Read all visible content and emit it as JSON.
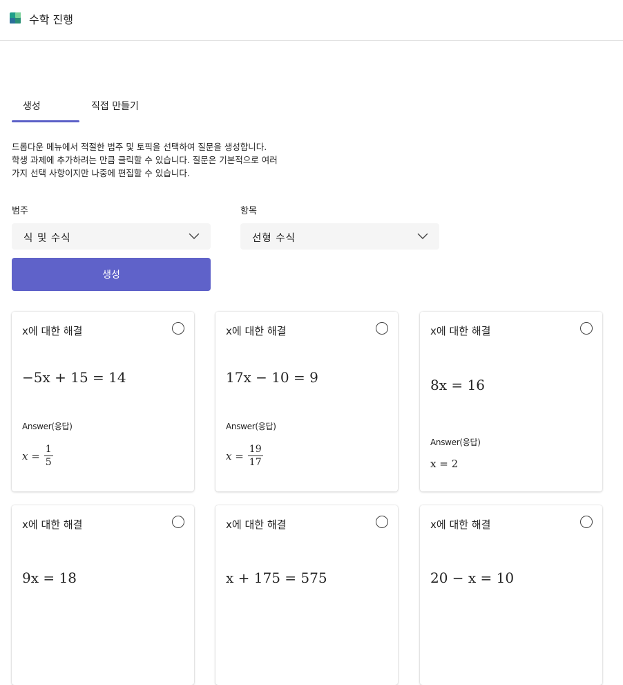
{
  "header": {
    "title": "수학 진행"
  },
  "tabs": [
    {
      "label": "생성",
      "selected": true
    },
    {
      "label": "직접 만들기",
      "selected": false
    }
  ],
  "description": [
    "드롭다운 메뉴에서 적절한 범주 및 토픽을 선택하여 질문을 생성합니다.",
    "학생 과제에 추가하려는 만큼 클릭할 수 있습니다. 질문은 기본적으로 여러",
    "가지 선택 사항이지만 나중에 편집할 수 있습니다."
  ],
  "category": {
    "label": "범주",
    "value": "식 및 수식"
  },
  "topic": {
    "label": "항목",
    "value": "선형 수식"
  },
  "generate_button": {
    "label": "생성"
  },
  "cards": [
    {
      "title": "x에 대한 해결",
      "equation": "−5x + 15 = 14",
      "answer_label": "Answer(응답)",
      "answer": "x = 1/5",
      "answer_lhs": "x =",
      "answer_num": "1",
      "answer_den": "5"
    },
    {
      "title": "x에 대한 해결",
      "equation": "17x − 10 = 9",
      "answer_label": "Answer(응답)",
      "answer": "x = 19/17",
      "answer_lhs": "x =",
      "answer_num": "19",
      "answer_den": "17"
    },
    {
      "title": "x에 대한 해결",
      "equation": "8x = 16",
      "answer_label": "Answer(응답)",
      "answer": "x = 2"
    },
    {
      "title": "x에 대한 해결",
      "equation": "9x = 18"
    },
    {
      "title": "x에 대한 해결",
      "equation": "x + 175 = 575"
    },
    {
      "title": "x에 대한 해결",
      "equation": "20 − x = 10"
    }
  ],
  "colors": {
    "accent": "#5b5fc7",
    "button": "#5f62c9",
    "select_bg": "#f5f5f5"
  },
  "icons": {
    "app": "app-logo-icon",
    "dropdown": "chevron-down-icon",
    "radio": "radio-button-icon"
  }
}
